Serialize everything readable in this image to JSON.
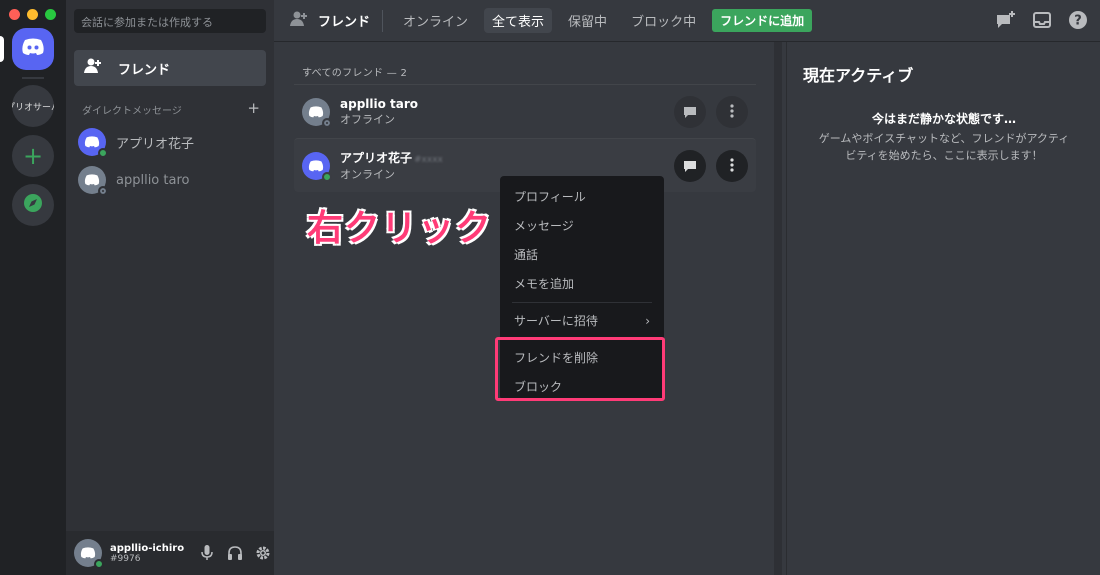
{
  "colors": {
    "brand": "#5865f2",
    "online": "#3ba55d",
    "highlight": "#ff3b77"
  },
  "rail": {
    "server_label": "アプリオサーバー"
  },
  "sidebar": {
    "search_placeholder": "会話に参加または作成する",
    "friends_label": "フレンド",
    "dm_header": "ダイレクトメッセージ",
    "dm_add": "+",
    "dms": [
      {
        "name": "アプリオ花子",
        "status": "online"
      },
      {
        "name": "appllio taro",
        "status": "offline"
      }
    ]
  },
  "user_panel": {
    "name": "appllio-ichiro",
    "tag": "#9976"
  },
  "header": {
    "title": "フレンド",
    "tabs": [
      "オンライン",
      "全て表示",
      "保留中",
      "ブロック中"
    ],
    "active_tab": "全て表示",
    "add_friend": "フレンドに追加"
  },
  "friends": {
    "section_label": "すべてのフレンド — 2",
    "items": [
      {
        "name": "appllio taro",
        "tag": "",
        "status": "オフライン"
      },
      {
        "name": "アプリオ花子",
        "tag": "#xxxx",
        "status": "オンライン"
      }
    ]
  },
  "annotation": "右クリック",
  "context_menu": {
    "items": [
      "プロフィール",
      "メッセージ",
      "通話",
      "メモを追加"
    ],
    "invite": "サーバーに招待",
    "invite_arrow": "›",
    "remove": "フレンドを削除",
    "block": "ブロック"
  },
  "active_now": {
    "title": "現在アクティブ",
    "empty_title": "今はまだ静かな状態です…",
    "empty_body": "ゲームやボイスチャットなど、フレンドがアクティビティを始めたら、ここに表示します！"
  }
}
